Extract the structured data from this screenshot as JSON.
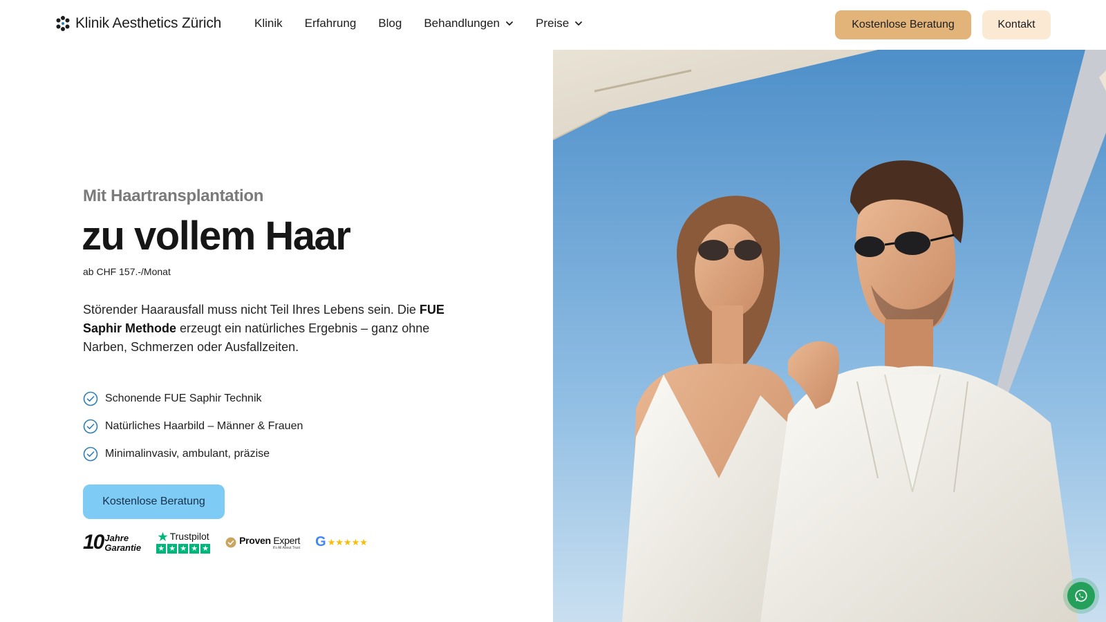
{
  "brand": {
    "name": "Klinik Aesthetics Zürich"
  },
  "nav": {
    "items": [
      {
        "label": "Klinik",
        "dropdown": false
      },
      {
        "label": "Erfahrung",
        "dropdown": false
      },
      {
        "label": "Blog",
        "dropdown": false
      },
      {
        "label": "Behandlungen",
        "dropdown": true
      },
      {
        "label": "Preise",
        "dropdown": true
      }
    ],
    "cta_label": "Kostenlose Beratung",
    "contact_label": "Kontakt"
  },
  "hero": {
    "eyebrow": "Mit Haartransplantation",
    "headline": "zu vollem Haar",
    "price": "ab CHF 157.-/Monat",
    "description": {
      "part1": "Störender Haarausfall muss nicht Teil Ihres Lebens sein. Die ",
      "bold": "FUE Saphir Methode",
      "part2": " erzeugt ein natürliches Ergebnis – ganz ohne Narben, Schmerzen oder Ausfallzeiten."
    },
    "features": [
      "Schonende FUE Saphir Technik",
      "Natürliches Haarbild – Männer & Frauen",
      "Minimalinvasiv, ambulant, präzise"
    ],
    "cta_label": "Kostenlose Beratung"
  },
  "trust": {
    "guarantee_number": "10",
    "guarantee_line1": "Jahre",
    "guarantee_line2": "Garantie",
    "trustpilot_label": "Trustpilot",
    "proven_label_bold": "Proven",
    "proven_label_rest": "Expert",
    "proven_sub": "It's All About Trust",
    "google_stars": "★★★★★"
  },
  "colors": {
    "accent_top_cta": "#e2b47a",
    "contact_bg": "#fbe9d3",
    "hero_cta": "#7ecbf5",
    "check": "#2a7fb8",
    "trustpilot": "#00b67a",
    "whatsapp": "#25a05a"
  },
  "icons": {
    "logo": "flower-logo-icon",
    "chevron": "chevron-down-icon",
    "check": "check-circle-icon",
    "whatsapp": "whatsapp-icon"
  }
}
